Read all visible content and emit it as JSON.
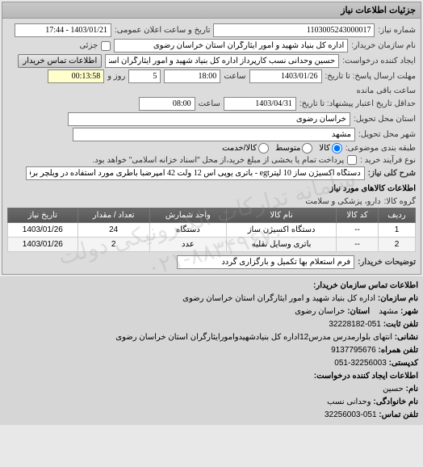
{
  "watermark": {
    "line1": "سامانه تدارکات الکترونیکی دولت",
    "line2": "۰۲۱-۸۸۳۴۹۶۷۰"
  },
  "panel_title": "جزئیات اطلاعات نیاز",
  "fields": {
    "req_number_label": "شماره نیاز:",
    "req_number": "1103005243000017",
    "announce_label": "تاریخ و ساعت اعلان عمومی:",
    "announce_value": "1403/01/21 - 17:44",
    "buyer_label": "نام سازمان خریدار:",
    "buyer_value": "اداره کل بنیاد شهید و امور ایثارگران استان خراسان رضوی",
    "partial_label": "جزئی",
    "requester_label": "ایجاد کننده درخواست:",
    "requester_value": "حسین وحدانی نسب کارپرداز اداره کل بنیاد شهید و امور ایثارگران استان خراسا",
    "contact_btn": "اطلاعات تماس خریدار",
    "deadline_label": "مهلت ارسال پاسخ: تا تاریخ:",
    "deadline_date": "1403/01/26",
    "deadline_time_label": "ساعت",
    "deadline_time": "18:00",
    "days_label": "روز و",
    "days_value": "5",
    "remaining_label": "ساعت باقی مانده",
    "remaining_time": "00:13:58",
    "validity_label": "حداقل تاریخ اعتبار پیشنهاد: تا تاریخ:",
    "validity_date": "1403/04/31",
    "validity_time_label": "ساعت",
    "validity_time": "08:00",
    "province_label": "استان محل تحویل:",
    "province_value": "خراسان رضوی",
    "city_label": "شهر محل تحویل:",
    "city_value": "مشهد",
    "priority_label": "طبقه بندی موضوعی:",
    "priority_options": {
      "kala": "کالا",
      "medium": "متوسط",
      "service": "کالا/خدمت"
    },
    "process_label": "نوع فرآیند خرید :",
    "process_value": "پرداخت تمام یا بخشی از مبلغ خرید،از محل \"اسناد خزانه اسلامی\" خواهد بود.",
    "desc_label": "شرح کلی نیاز:",
    "desc_value": "دستگاه اکسیژن ساز 10 لیترegt - باتری یوپی اس 12 ولت 42 آمپرضبا باطری مورد استفاده در ویلچر برقی",
    "items_label": "اطلاعات کالاهای مورد نیاز",
    "group_label": "گروه کالا:",
    "group_value": "دارو، پزشکی و سلامت",
    "buyer_note_label": "توضیحات خریدار:",
    "buyer_note_value": "فرم استعلام بها تکمیل و بارگزاری گردد"
  },
  "table": {
    "headers": [
      "ردیف",
      "کد کالا",
      "نام کالا",
      "واحد شمارش",
      "تعداد / مقدار",
      "تاریخ نیاز"
    ],
    "rows": [
      [
        "1",
        "--",
        "دستگاه اکسیژن ساز",
        "دستگاه",
        "24",
        "1403/01/26"
      ],
      [
        "2",
        "--",
        "باتری وسایل نقلیه",
        "عدد",
        "2",
        "1403/01/26"
      ]
    ]
  },
  "contact": {
    "title1": "اطلاعات تماس سازمان خریدار:",
    "org_label": "نام سازمان:",
    "org_value": "اداره کل بنیاد شهید و امور ایثارگران استان خراسان رضوی",
    "city_label": "شهر:",
    "city_value": "مشهد",
    "province_label": "استان:",
    "province_value": "خراسان رضوی",
    "phone_label": "تلفن ثابت:",
    "phone_value": "051-32228182",
    "address_label": "نشانی:",
    "address_value": "انتهای بلوارمدرس مدرس12اداره کل بنیادشهیدوامورایثارگران استان خراسان رضوی",
    "fax_label": "تلفن همراه:",
    "fax_value": "9137795676",
    "postal_label": "کدپستی:",
    "postal_value": "32256003-051",
    "title2": "اطلاعات ایجاد کننده درخواست:",
    "name_label": "نام:",
    "name_value": "حسین",
    "lastname_label": "نام خانوادگی:",
    "lastname_value": "وحدانی نسب",
    "phone2_label": "تلفن تماس:",
    "phone2_value": "051-32256003"
  }
}
